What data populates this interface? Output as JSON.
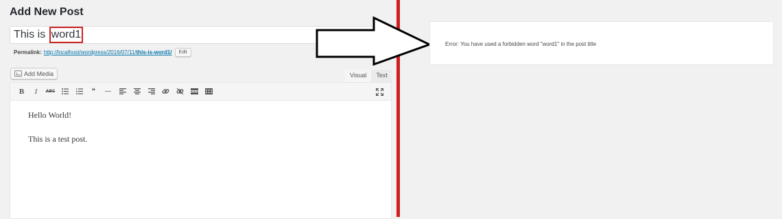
{
  "editor_screen": {
    "page_title": "Add New Post",
    "post_title_prefix": "This is ",
    "post_title_highlight": "word1",
    "permalink_label": "Permalink:",
    "permalink_url_base": "http://localhost/wordpress/2016/07/11/",
    "permalink_slug": "this-is-word1/",
    "edit_label": "Edit",
    "add_media_label": "Add Media",
    "tab_visual": "Visual",
    "tab_text": "Text",
    "toolbar_buttons": [
      "bold",
      "italic",
      "strikethrough",
      "bulleted-list",
      "numbered-list",
      "blockquote",
      "horizontal-line",
      "align-left",
      "align-center",
      "align-right",
      "insert-link",
      "remove-link",
      "read-more",
      "toolbar-toggle"
    ],
    "toolbar_glyphs": {
      "bold": "B",
      "italic": "I",
      "strikethrough": "ABC",
      "blockquote": "❝",
      "horizontal_line": "—"
    },
    "content_lines": [
      "Hello World!",
      "This is a test post."
    ]
  },
  "error_panel": {
    "message": "Error: You have used a forbidden word \"word1\" in the post title"
  },
  "colors": {
    "divider": "#cc1f1f",
    "highlight_border": "#cc2222",
    "link": "#0073aa"
  }
}
